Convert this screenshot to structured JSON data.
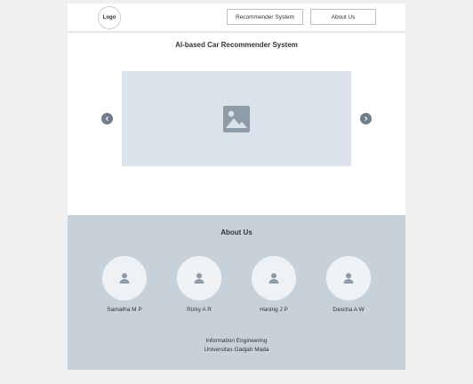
{
  "header": {
    "logo_label": "Logo",
    "nav": {
      "recommender_label": "Recommender System",
      "about_label": "About Us"
    }
  },
  "hero": {
    "title": "AI-based Car Recommender System",
    "image_icon": "image-placeholder-icon",
    "prev_icon": "chevron-left-icon",
    "next_icon": "chevron-right-icon"
  },
  "about": {
    "title": "About Us",
    "members": [
      {
        "name": "Samatha M P",
        "icon": "user-icon"
      },
      {
        "name": "Rizky A R",
        "icon": "user-icon"
      },
      {
        "name": "Haning J P",
        "icon": "user-icon"
      },
      {
        "name": "Dascha A W",
        "icon": "user-icon"
      }
    ],
    "institution_line1": "Information Engineering",
    "institution_line2": "Universitas Gadjah Mada"
  },
  "colors": {
    "page_bg": "#f0f0f0",
    "about_bg": "#c6d1da",
    "image_bg": "#dbe2ea",
    "arrow_bg": "#6f7d8a"
  }
}
